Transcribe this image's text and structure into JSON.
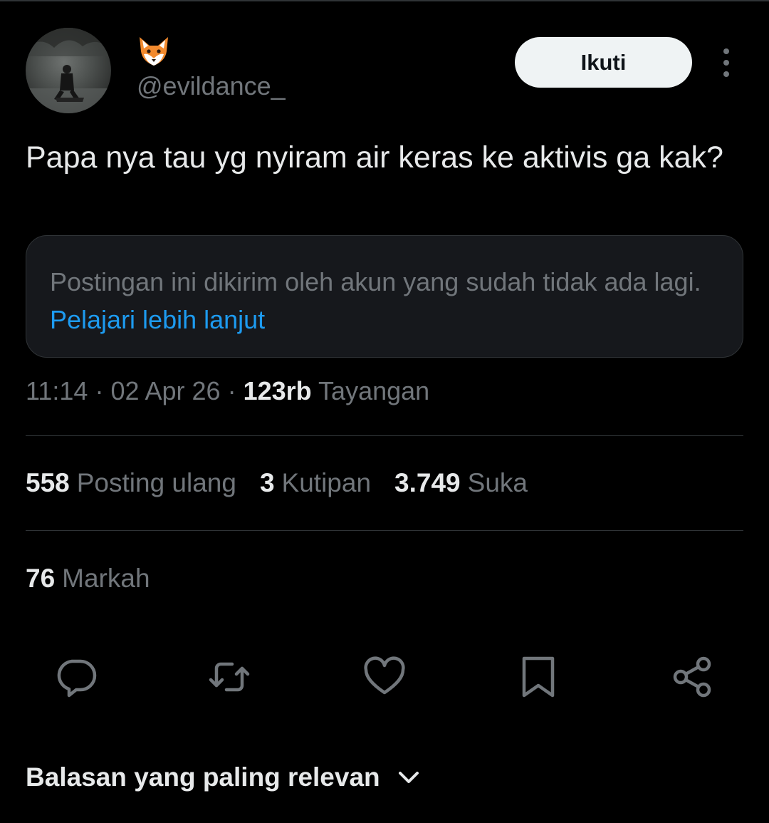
{
  "header": {
    "display_name_icon": "fox-face-emoji",
    "handle": "@evildance_",
    "follow_label": "Ikuti"
  },
  "tweet": {
    "text": "Papa nya tau yg nyiram air keras ke aktivis ga kak?"
  },
  "notice": {
    "text": "Postingan ini dikirim oleh akun yang sudah tidak ada lagi.",
    "link": "Pelajari lebih lanjut"
  },
  "meta": {
    "time": "11:14",
    "date": "02 Apr 26",
    "views_count": "123rb",
    "views_label": "Tayangan"
  },
  "stats": {
    "reposts_count": "558",
    "reposts_label": "Posting ulang",
    "quotes_count": "3",
    "quotes_label": "Kutipan",
    "likes_count": "3.749",
    "likes_label": "Suka",
    "bookmarks_count": "76",
    "bookmarks_label": "Markah"
  },
  "actions": [
    "reply-icon",
    "repost-icon",
    "like-icon",
    "bookmark-icon",
    "share-icon"
  ],
  "replies": {
    "label": "Balasan yang paling relevan"
  },
  "colors": {
    "background": "#000000",
    "text": "#e7e9ea",
    "muted": "#71767b",
    "link": "#1d9bf0",
    "divider": "#2f3336",
    "notice_bg": "#16181c",
    "follow_bg": "#eff3f4"
  }
}
